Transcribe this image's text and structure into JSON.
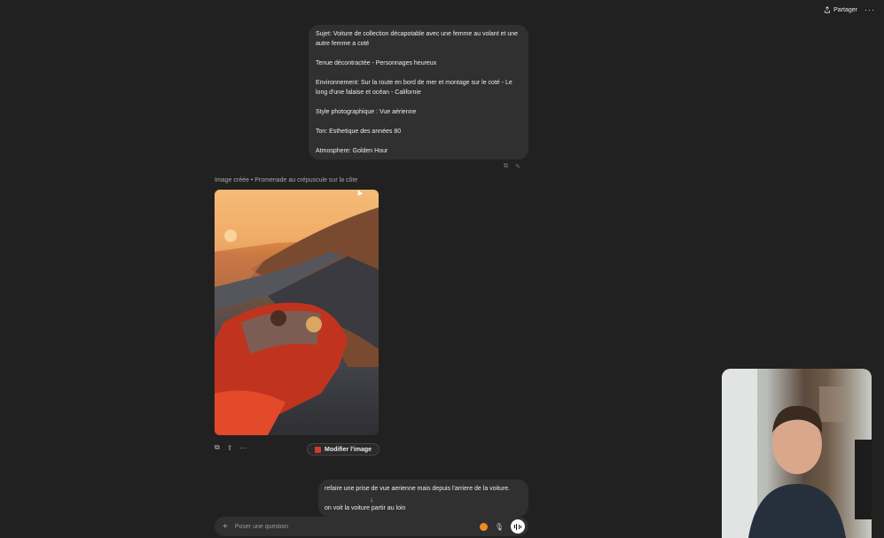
{
  "topbar": {
    "share_label": "Partager",
    "more_label": "···"
  },
  "prompt": {
    "paragraphs": [
      "Sujet: Voiture de collection décapotable avec une femme au volant et une autre femme a coté",
      "Tenue décontractée - Personnages heureux",
      "Environnement: Sur la route en bord de mer et montage sur le coté - Le long d'une falaise et océan - Californie",
      "Style photographique : Vue aérienne",
      "Ton: Esthetique des années 80",
      "Atmosphere: Golden Hour"
    ]
  },
  "image_result": {
    "caption_prefix": "Image créée •",
    "caption_title": "Promenade au crépuscule sur la côte",
    "edit_label": "Modifier l'image"
  },
  "followup": {
    "paragraphs": [
      "refaire une prise de vue aerienne mais depuis l'arriere de la voiture.",
      "on voit la voiture partir au loin"
    ]
  },
  "composer": {
    "placeholder": "Poser une question"
  },
  "colors": {
    "background": "#212121",
    "bubble": "#303030",
    "accent_orange": "#f08a24",
    "edit_icon_red": "#d03a2a"
  }
}
